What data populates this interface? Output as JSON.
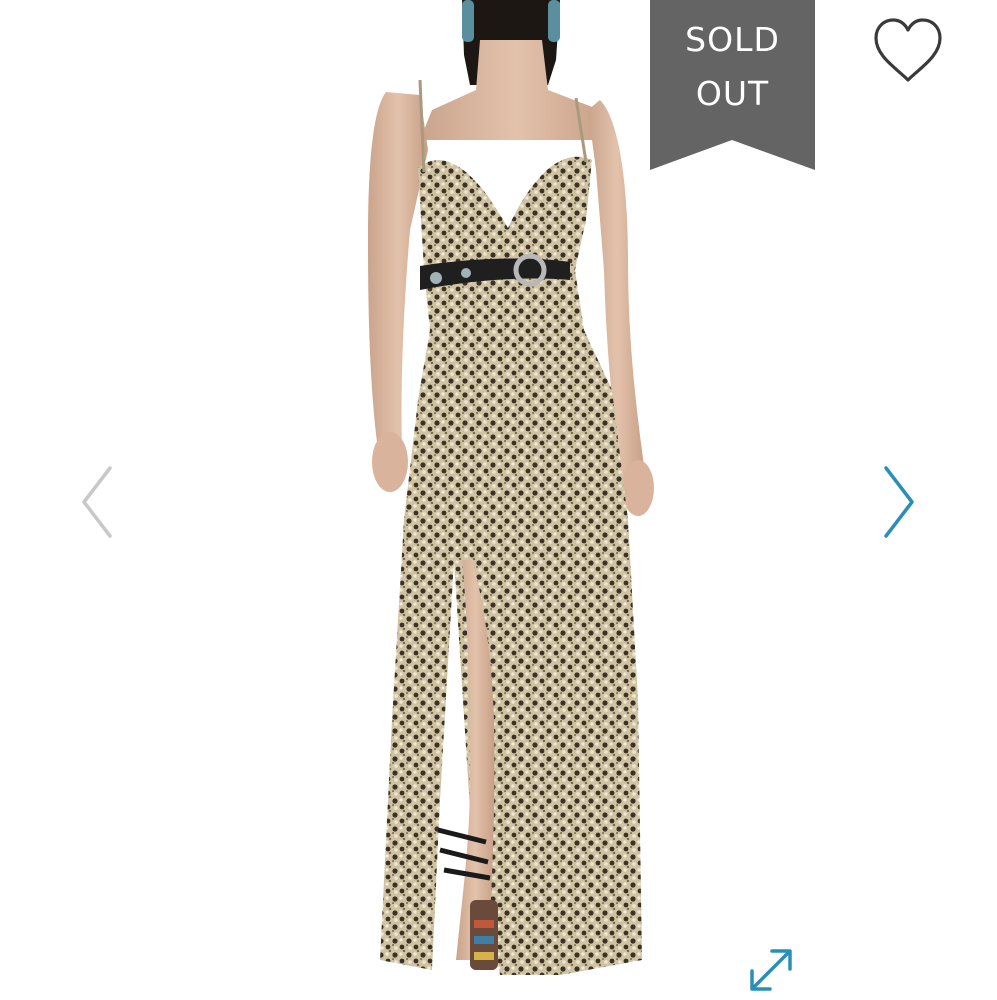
{
  "badge": {
    "line1": "SOLD",
    "line2": "OUT",
    "color": "#646464"
  },
  "icons": {
    "prev": "chevron-left-icon",
    "next": "chevron-right-icon",
    "wishlist": "heart-outline-icon",
    "expand": "expand-diagonal-icon"
  },
  "colors": {
    "accent": "#2a8fb8",
    "nav_inactive": "#c8c8c8",
    "icon_dark": "#3a3a3a",
    "background": "#ffffff"
  }
}
